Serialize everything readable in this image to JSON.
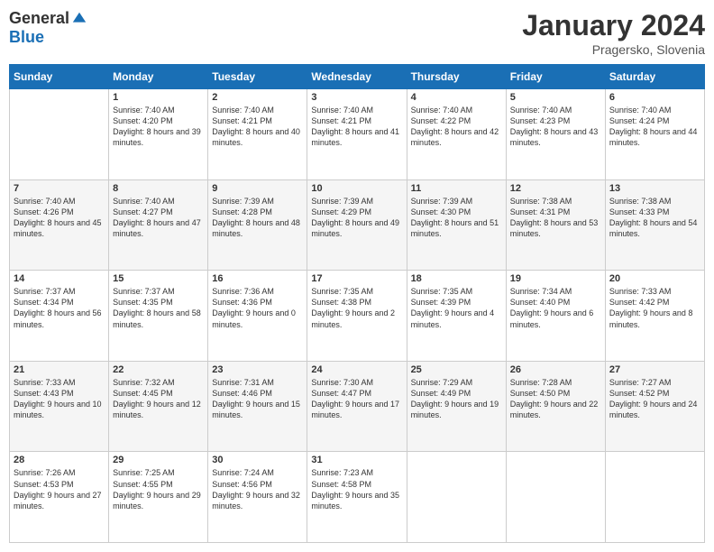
{
  "logo": {
    "general": "General",
    "blue": "Blue"
  },
  "title": "January 2024",
  "location": "Pragersko, Slovenia",
  "days": [
    "Sunday",
    "Monday",
    "Tuesday",
    "Wednesday",
    "Thursday",
    "Friday",
    "Saturday"
  ],
  "weeks": [
    [
      {
        "day": "",
        "sunrise": "",
        "sunset": "",
        "daylight": ""
      },
      {
        "day": "1",
        "sunrise": "Sunrise: 7:40 AM",
        "sunset": "Sunset: 4:20 PM",
        "daylight": "Daylight: 8 hours and 39 minutes."
      },
      {
        "day": "2",
        "sunrise": "Sunrise: 7:40 AM",
        "sunset": "Sunset: 4:21 PM",
        "daylight": "Daylight: 8 hours and 40 minutes."
      },
      {
        "day": "3",
        "sunrise": "Sunrise: 7:40 AM",
        "sunset": "Sunset: 4:21 PM",
        "daylight": "Daylight: 8 hours and 41 minutes."
      },
      {
        "day": "4",
        "sunrise": "Sunrise: 7:40 AM",
        "sunset": "Sunset: 4:22 PM",
        "daylight": "Daylight: 8 hours and 42 minutes."
      },
      {
        "day": "5",
        "sunrise": "Sunrise: 7:40 AM",
        "sunset": "Sunset: 4:23 PM",
        "daylight": "Daylight: 8 hours and 43 minutes."
      },
      {
        "day": "6",
        "sunrise": "Sunrise: 7:40 AM",
        "sunset": "Sunset: 4:24 PM",
        "daylight": "Daylight: 8 hours and 44 minutes."
      }
    ],
    [
      {
        "day": "7",
        "sunrise": "Sunrise: 7:40 AM",
        "sunset": "Sunset: 4:26 PM",
        "daylight": "Daylight: 8 hours and 45 minutes."
      },
      {
        "day": "8",
        "sunrise": "Sunrise: 7:40 AM",
        "sunset": "Sunset: 4:27 PM",
        "daylight": "Daylight: 8 hours and 47 minutes."
      },
      {
        "day": "9",
        "sunrise": "Sunrise: 7:39 AM",
        "sunset": "Sunset: 4:28 PM",
        "daylight": "Daylight: 8 hours and 48 minutes."
      },
      {
        "day": "10",
        "sunrise": "Sunrise: 7:39 AM",
        "sunset": "Sunset: 4:29 PM",
        "daylight": "Daylight: 8 hours and 49 minutes."
      },
      {
        "day": "11",
        "sunrise": "Sunrise: 7:39 AM",
        "sunset": "Sunset: 4:30 PM",
        "daylight": "Daylight: 8 hours and 51 minutes."
      },
      {
        "day": "12",
        "sunrise": "Sunrise: 7:38 AM",
        "sunset": "Sunset: 4:31 PM",
        "daylight": "Daylight: 8 hours and 53 minutes."
      },
      {
        "day": "13",
        "sunrise": "Sunrise: 7:38 AM",
        "sunset": "Sunset: 4:33 PM",
        "daylight": "Daylight: 8 hours and 54 minutes."
      }
    ],
    [
      {
        "day": "14",
        "sunrise": "Sunrise: 7:37 AM",
        "sunset": "Sunset: 4:34 PM",
        "daylight": "Daylight: 8 hours and 56 minutes."
      },
      {
        "day": "15",
        "sunrise": "Sunrise: 7:37 AM",
        "sunset": "Sunset: 4:35 PM",
        "daylight": "Daylight: 8 hours and 58 minutes."
      },
      {
        "day": "16",
        "sunrise": "Sunrise: 7:36 AM",
        "sunset": "Sunset: 4:36 PM",
        "daylight": "Daylight: 9 hours and 0 minutes."
      },
      {
        "day": "17",
        "sunrise": "Sunrise: 7:35 AM",
        "sunset": "Sunset: 4:38 PM",
        "daylight": "Daylight: 9 hours and 2 minutes."
      },
      {
        "day": "18",
        "sunrise": "Sunrise: 7:35 AM",
        "sunset": "Sunset: 4:39 PM",
        "daylight": "Daylight: 9 hours and 4 minutes."
      },
      {
        "day": "19",
        "sunrise": "Sunrise: 7:34 AM",
        "sunset": "Sunset: 4:40 PM",
        "daylight": "Daylight: 9 hours and 6 minutes."
      },
      {
        "day": "20",
        "sunrise": "Sunrise: 7:33 AM",
        "sunset": "Sunset: 4:42 PM",
        "daylight": "Daylight: 9 hours and 8 minutes."
      }
    ],
    [
      {
        "day": "21",
        "sunrise": "Sunrise: 7:33 AM",
        "sunset": "Sunset: 4:43 PM",
        "daylight": "Daylight: 9 hours and 10 minutes."
      },
      {
        "day": "22",
        "sunrise": "Sunrise: 7:32 AM",
        "sunset": "Sunset: 4:45 PM",
        "daylight": "Daylight: 9 hours and 12 minutes."
      },
      {
        "day": "23",
        "sunrise": "Sunrise: 7:31 AM",
        "sunset": "Sunset: 4:46 PM",
        "daylight": "Daylight: 9 hours and 15 minutes."
      },
      {
        "day": "24",
        "sunrise": "Sunrise: 7:30 AM",
        "sunset": "Sunset: 4:47 PM",
        "daylight": "Daylight: 9 hours and 17 minutes."
      },
      {
        "day": "25",
        "sunrise": "Sunrise: 7:29 AM",
        "sunset": "Sunset: 4:49 PM",
        "daylight": "Daylight: 9 hours and 19 minutes."
      },
      {
        "day": "26",
        "sunrise": "Sunrise: 7:28 AM",
        "sunset": "Sunset: 4:50 PM",
        "daylight": "Daylight: 9 hours and 22 minutes."
      },
      {
        "day": "27",
        "sunrise": "Sunrise: 7:27 AM",
        "sunset": "Sunset: 4:52 PM",
        "daylight": "Daylight: 9 hours and 24 minutes."
      }
    ],
    [
      {
        "day": "28",
        "sunrise": "Sunrise: 7:26 AM",
        "sunset": "Sunset: 4:53 PM",
        "daylight": "Daylight: 9 hours and 27 minutes."
      },
      {
        "day": "29",
        "sunrise": "Sunrise: 7:25 AM",
        "sunset": "Sunset: 4:55 PM",
        "daylight": "Daylight: 9 hours and 29 minutes."
      },
      {
        "day": "30",
        "sunrise": "Sunrise: 7:24 AM",
        "sunset": "Sunset: 4:56 PM",
        "daylight": "Daylight: 9 hours and 32 minutes."
      },
      {
        "day": "31",
        "sunrise": "Sunrise: 7:23 AM",
        "sunset": "Sunset: 4:58 PM",
        "daylight": "Daylight: 9 hours and 35 minutes."
      },
      {
        "day": "",
        "sunrise": "",
        "sunset": "",
        "daylight": ""
      },
      {
        "day": "",
        "sunrise": "",
        "sunset": "",
        "daylight": ""
      },
      {
        "day": "",
        "sunrise": "",
        "sunset": "",
        "daylight": ""
      }
    ]
  ]
}
